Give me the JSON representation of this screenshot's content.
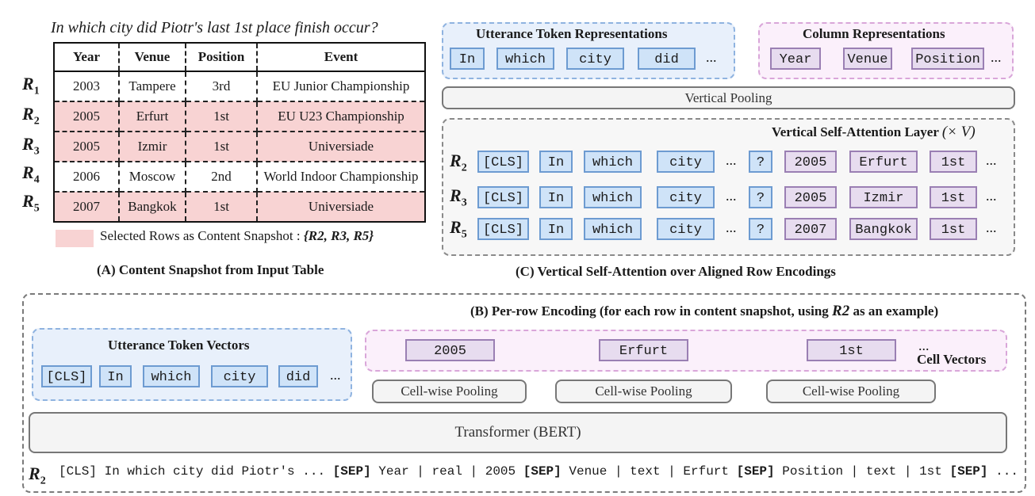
{
  "panel_a": {
    "question": "In which city did Piotr's last 1st place finish occur?",
    "columns": [
      "Year",
      "Venue",
      "Position",
      "Event"
    ],
    "rows": [
      {
        "label": "R",
        "sub": "1",
        "selected": false,
        "cells": [
          "2003",
          "Tampere",
          "3rd",
          "EU Junior Championship"
        ]
      },
      {
        "label": "R",
        "sub": "2",
        "selected": true,
        "cells": [
          "2005",
          "Erfurt",
          "1st",
          "EU U23 Championship"
        ]
      },
      {
        "label": "R",
        "sub": "3",
        "selected": true,
        "cells": [
          "2005",
          "Izmir",
          "1st",
          "Universiade"
        ]
      },
      {
        "label": "R",
        "sub": "4",
        "selected": false,
        "cells": [
          "2006",
          "Moscow",
          "2nd",
          "World Indoor Championship"
        ]
      },
      {
        "label": "R",
        "sub": "5",
        "selected": true,
        "cells": [
          "2007",
          "Bangkok",
          "1st",
          "Universiade"
        ]
      }
    ],
    "legend_text": "Selected Rows as Content Snapshot :",
    "legend_set": "{R2, R3, R5}",
    "caption": "(A) Content Snapshot from Input Table"
  },
  "panel_c": {
    "utterance_title": "Utterance Token Representations",
    "utterance_tokens": [
      "In",
      "which",
      "city",
      "did"
    ],
    "column_title": "Column Representations",
    "column_tokens": [
      "Year",
      "Venue",
      "Position"
    ],
    "ellipsis": "...",
    "vertical_pooling": "Vertical Pooling",
    "layer_title": "Vertical Self-Attention Layer",
    "layer_multiplier": "(× V)",
    "rows": [
      {
        "label": "R",
        "sub": "2",
        "tokens": [
          "[CLS]",
          "In",
          "which",
          "city"
        ],
        "q": "?",
        "cells": [
          "2005",
          "Erfurt",
          "1st"
        ]
      },
      {
        "label": "R",
        "sub": "3",
        "tokens": [
          "[CLS]",
          "In",
          "which",
          "city"
        ],
        "q": "?",
        "cells": [
          "2005",
          "Izmir",
          "1st"
        ]
      },
      {
        "label": "R",
        "sub": "5",
        "tokens": [
          "[CLS]",
          "In",
          "which",
          "city"
        ],
        "q": "?",
        "cells": [
          "2007",
          "Bangkok",
          "1st"
        ]
      }
    ],
    "caption": "(C) Vertical Self-Attention over Aligned Row Encodings"
  },
  "panel_b": {
    "title": "(B) Per-row Encoding (for each row in content snapshot, using",
    "title_row": "R2",
    "title_suffix": "as an example)",
    "utterance_title": "Utterance Token Vectors",
    "utterance_tokens": [
      "[CLS]",
      "In",
      "which",
      "city",
      "did"
    ],
    "cell_tokens": [
      "2005",
      "Erfurt",
      "1st"
    ],
    "cell_vectors_label": "Cell Vectors",
    "pooling_label": "Cell-wise Pooling",
    "transformer_label": "Transformer (BERT)",
    "row_label": "R",
    "row_sub": "2",
    "sequence": [
      {
        "t": "[CLS] In which city did Piotr's ...",
        "b": false
      },
      {
        "t": "[SEP]",
        "b": true
      },
      {
        "t": "Year | real | 2005",
        "b": false
      },
      {
        "t": "[SEP]",
        "b": true
      },
      {
        "t": "Venue | text | Erfurt",
        "b": false
      },
      {
        "t": "[SEP]",
        "b": true
      },
      {
        "t": "Position | text | 1st",
        "b": false
      },
      {
        "t": "[SEP]",
        "b": true
      },
      {
        "t": "...",
        "b": false
      }
    ]
  },
  "colors": {
    "selected_row": "#f8d3d3",
    "utterance_token": "#cfe3f8",
    "column_token": "#e7dcef"
  }
}
